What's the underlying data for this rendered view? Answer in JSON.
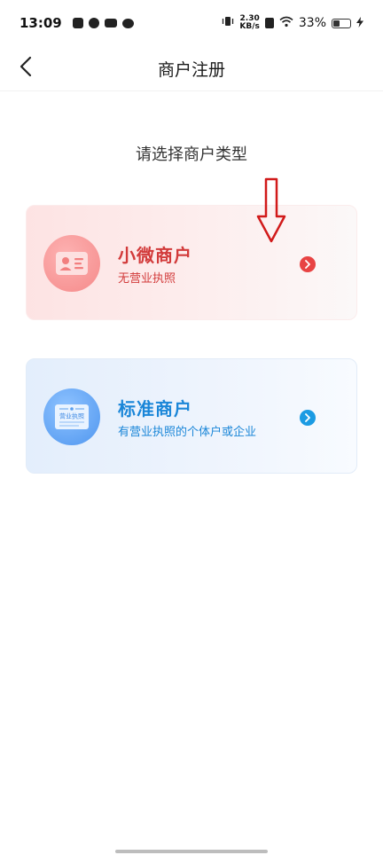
{
  "status_bar": {
    "time": "13:09",
    "net_speed_value": "2.30",
    "net_speed_unit": "KB/s",
    "battery_percent": "33%",
    "icons": [
      "message-icon",
      "check-icon",
      "app-icon",
      "wechat-icon",
      "vibrate-icon",
      "sim-icon",
      "wifi-icon",
      "battery-icon",
      "charging-icon"
    ]
  },
  "header": {
    "title": "商户注册",
    "back_icon": "chevron-left-icon"
  },
  "subtitle": "请选择商户类型",
  "cards": [
    {
      "title": "小微商户",
      "description": "无营业执照",
      "icon": "id-card-icon",
      "accent": "#d23a3a"
    },
    {
      "title": "标准商户",
      "description": "有营业执照的个体户或企业",
      "icon": "business-license-icon",
      "icon_text": "营业执照",
      "accent": "#1a86d8"
    }
  ]
}
